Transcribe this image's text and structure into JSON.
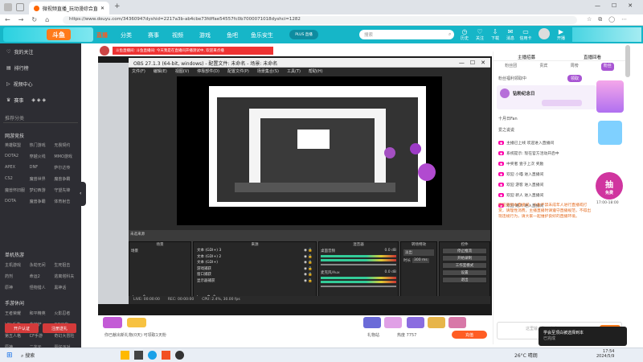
{
  "browser": {
    "tab_title": "微视频直播_玩动漫综合直播",
    "url": "https://www.douyu.com/34360947dyshid=2217a3b-ab4cbe73fdffae54557fc0b7000071018dyshci=1282"
  },
  "site": {
    "logo": "斗鱼",
    "nav": [
      "直播",
      "分类",
      "赛事",
      "视频",
      "游戏",
      "鱼吧",
      "鱼乐安生"
    ],
    "promo_badge": "PLUS 直播",
    "search_placeholder": "搜索",
    "header_icons": [
      "历史",
      "关注",
      "下载",
      "消息",
      "信用卡",
      "开播"
    ]
  },
  "sidebar": {
    "items": [
      "我的关注",
      "排行榜",
      "视频中心",
      "赛事"
    ],
    "popular_head": "推荐分类",
    "online_head": "网游竞技",
    "online_games": [
      "英雄联盟",
      "热门游戏",
      "无畏契约",
      "DOTA2",
      "穿越火线",
      "MMO游戏",
      "APEX",
      "DNF",
      "萨尔达传",
      "CS2",
      "魔兽世界",
      "魔兽争霸",
      "魔兽怀旧服",
      "梦幻西游",
      "守望先锋",
      "DOTA",
      "魔兽争霸",
      "体育射击"
    ],
    "mobile_head": "单机热游",
    "mobile_games": [
      "主机游戏",
      "永劫无间",
      "生死狙击",
      "药剂",
      "命运2",
      "逃离塔科夫",
      "原神",
      "怪物猎人",
      "黑神话"
    ],
    "handheld_head": "手游休闲",
    "handheld_games": [
      "王者荣耀",
      "和平精英",
      "火影忍者",
      "LOL手游",
      "金铲铲",
      "QQ飞车",
      "第五人格",
      "CF手游",
      "奇幻大冒险",
      "原神",
      "二次元",
      "蛋仔派对",
      "部落冲突",
      "其他手游",
      "元梦之星"
    ],
    "btn1": "开户认证",
    "btn2": "注册送礼"
  },
  "stream": {
    "banner_text": "斗鱼直播间: 斗鱼直播间: 今天我是在直播间开播测试中, 欢迎来点播",
    "obs_title": "OBS 27.1.3 (64-bit, windows) - 配置文件: 未命名 - 场景: 未命名",
    "obs_menu": [
      "文件(F)",
      "编辑(E)",
      "视图(V)",
      "停靠部件(D)",
      "配置文件(P)",
      "场景集合(S)",
      "工具(T)",
      "帮助(H)"
    ],
    "scene_header": "场景",
    "source_header": "来源",
    "mixer_header": "混音器",
    "transition_header": "转场特效",
    "controls_header": "控件",
    "scene_name": "场景",
    "sources": [
      "文本 (GDI+) 3",
      "文本 (GDI+) 2",
      "文本 (GDI+)",
      "游戏捕获",
      "窗口捕获",
      "显示器捕获"
    ],
    "mixer_tracks": [
      "桌面音频",
      "麦克风/Aux"
    ],
    "mixer_db": [
      "0.0 dB",
      "0.0 dB"
    ],
    "transition_value": "淡出",
    "duration_label": "时长",
    "duration_value": "300 ms",
    "controls": [
      "停止推流",
      "开始录制",
      "工作室模式",
      "设置",
      "退出"
    ],
    "status_items": [
      "LIVE: 00:00:00",
      "REC: 00:00:00",
      "CPU: 2.4%, 30.00 fps"
    ],
    "watchers_label": "礼物站",
    "hot_value": "热度 7757",
    "gift_hint": "你已献出新礼物(0天) 可领取1天粉"
  },
  "chat": {
    "tabs": [
      "主播招募",
      "直播回看"
    ],
    "sub_tabs": [
      "粉丝团",
      "贵宾",
      "周榜",
      "粉丝"
    ],
    "notice": "粉丝福利领取中",
    "notice_btn": "领取",
    "streamer_name": "钻粉纪念日",
    "rank_lines": [
      "十月日Fan",
      "爱之说说"
    ],
    "messages": [
      "主播已上线 欢迎进入直播间",
      "系统提示: 现在官方活动开启中",
      "中奖者 壹于上次 奖励",
      "欢迎 小喵 进入直播间",
      "欢迎 游客 进入直播间",
      "欢迎 新人 进入直播间",
      "欢迎 路人 进入直播间"
    ],
    "notice_long": "欢迎来到本直播间，斗鱼严禁未成年人进行直播或打赏，请理性消费，主播直播时请遵守直播规范，不得出现违规行为，请大家一起维护良好的直播环境。",
    "gift_button": "抽",
    "gift_sub": "免费",
    "input_placeholder": "这里输入聊天内容",
    "send": "发送",
    "time_badge": "17:00-18:00"
  },
  "taskbar": {
    "search": "搜索",
    "weather": "26°C 晴朗",
    "time": "17:54",
    "date": "2024/5/9",
    "notify": "学会至顶白被选择到本",
    "notify_sub": "已完成"
  }
}
